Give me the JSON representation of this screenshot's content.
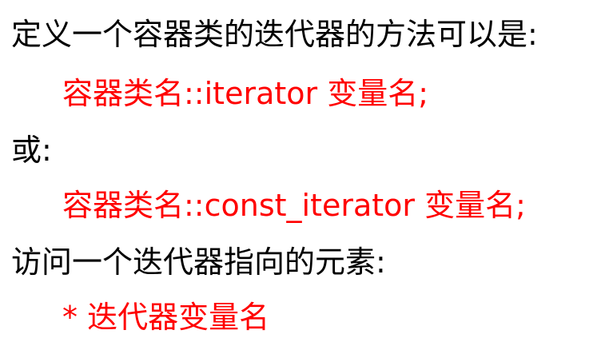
{
  "lines": [
    {
      "text": "定义一个容器类的迭代器的方法可以是:"
    },
    {
      "text": "容器类名::iterator   变量名;"
    },
    {
      "text": "或:"
    },
    {
      "text": "容器类名::const_iterator 变量名;"
    },
    {
      "text": "访问一个迭代器指向的元素:"
    },
    {
      "text": "* 迭代器变量名"
    }
  ],
  "colors": {
    "heading": "#000000",
    "code": "#ff0000",
    "background": "#ffffff"
  }
}
